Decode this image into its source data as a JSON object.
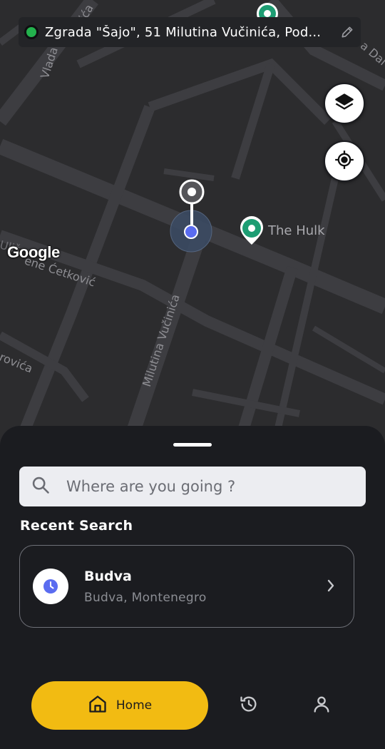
{
  "map": {
    "address": "Zgrada \"Šajo\", 51 Milutina Vučinića, Pod...",
    "road_labels": [
      "Vlada",
      "Milutina Vučinića",
      "ene Ćetković",
      "rovića",
      "ića",
      "a Dal",
      "Uliš"
    ],
    "poi_name": "The Hulk",
    "attribution": "Google",
    "colors": {
      "status_dot": "#23b14d",
      "poi_pin": "#1d9d73",
      "location_dot": "#5a6cf0"
    },
    "icons": {
      "edit": "pencil-icon",
      "layers": "layers-icon",
      "locate": "crosshair-icon"
    }
  },
  "sheet": {
    "search_placeholder": "Where are you going ?",
    "recent_title": "Recent Search",
    "recent": [
      {
        "name": "Budva",
        "subtitle": "Budva, Montenegro",
        "icon": "clock-icon"
      }
    ]
  },
  "nav": {
    "home_label": "Home",
    "accent": "#f2bb12",
    "icons": [
      "home-icon",
      "history-icon",
      "profile-icon"
    ]
  }
}
